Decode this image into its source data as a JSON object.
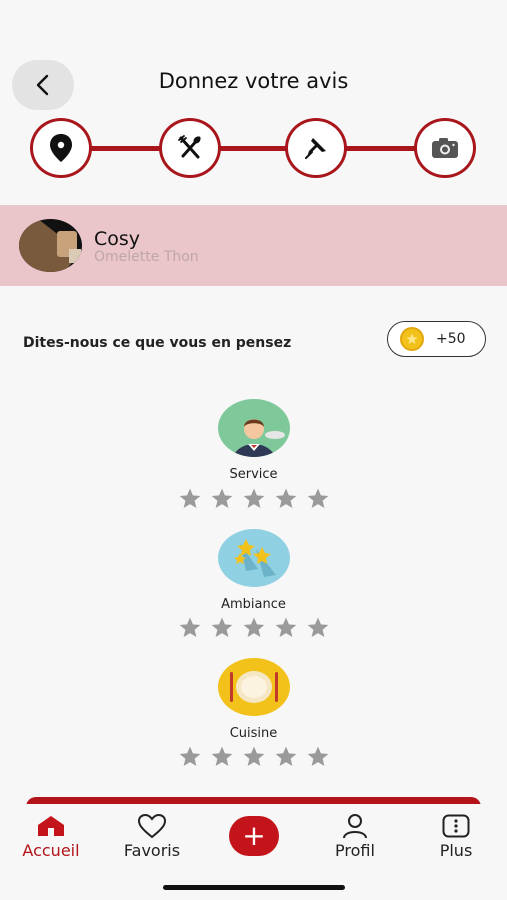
{
  "header": {
    "title": "Donnez votre avis",
    "back_icon": "chevron-left-icon"
  },
  "steps": [
    {
      "name": "location-pin-icon"
    },
    {
      "name": "fork-knife-icon"
    },
    {
      "name": "pushpin-icon"
    },
    {
      "name": "camera-icon"
    }
  ],
  "restaurant": {
    "name": "Cosy",
    "dish": "Omelette Thon"
  },
  "feedback": {
    "prompt": "Dites-nous ce que vous en pensez",
    "points": "+50"
  },
  "criteria": [
    {
      "label": "Service",
      "rating": 0,
      "max": 5
    },
    {
      "label": "Ambiance",
      "rating": 0,
      "max": 5
    },
    {
      "label": "Cuisine",
      "rating": 0,
      "max": 5
    }
  ],
  "tabbar": {
    "home": "Accueil",
    "favorites": "Favoris",
    "add": "+",
    "profile": "Profil",
    "more": "Plus"
  },
  "colors": {
    "brand": "#b3141a",
    "highlight_band": "#eac6cb",
    "star_empty": "#9a9a9a"
  }
}
